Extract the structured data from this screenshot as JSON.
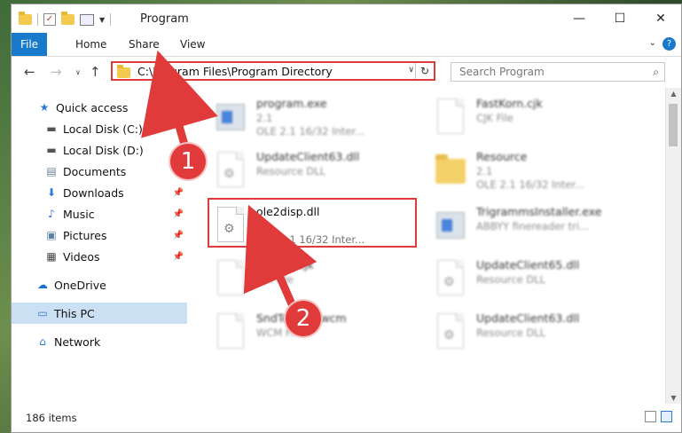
{
  "window": {
    "title": "Program"
  },
  "title_buttons": {
    "minimize": "—",
    "maximize": "☐",
    "close": "✕"
  },
  "ribbon": {
    "tabs": [
      "File",
      "Home",
      "Share",
      "View"
    ],
    "help": "?"
  },
  "address": {
    "path": "C:\\Program Files\\Program Directory"
  },
  "search": {
    "placeholder": "Search Program"
  },
  "nav": {
    "items": [
      {
        "label": "Quick access",
        "icon": "star-icon"
      },
      {
        "label": "Local Disk (C:)",
        "icon": "drive-icon"
      },
      {
        "label": "Local Disk (D:)",
        "icon": "drive-icon"
      },
      {
        "label": "Documents",
        "icon": "documents-icon"
      },
      {
        "label": "Downloads",
        "icon": "download-icon"
      },
      {
        "label": "Music",
        "icon": "music-icon"
      },
      {
        "label": "Pictures",
        "icon": "pictures-icon"
      },
      {
        "label": "Videos",
        "icon": "videos-icon"
      },
      {
        "label": "OneDrive",
        "icon": "cloud-icon"
      },
      {
        "label": "This PC",
        "icon": "computer-icon"
      },
      {
        "label": "Network",
        "icon": "network-icon"
      }
    ]
  },
  "files": [
    {
      "name": "program.exe",
      "line1": "2.1",
      "line2": "OLE 2.1 16/32 Inter..."
    },
    {
      "name": "FastKorn.cjk",
      "line1": "CJK File",
      "line2": ""
    },
    {
      "name": "UpdateClient63.dll",
      "line1": "Resource DLL",
      "line2": ""
    },
    {
      "name": "Resource",
      "line1": "2.1",
      "line2": "OLE 2.1 16/32 Inter..."
    },
    {
      "name": "ole2disp.dll",
      "line1": "2.1",
      "line2": "OLE 2.1 16/32 Inter..."
    },
    {
      "name": "TrigrammsInstaller.exe",
      "line1": "ABBYY finereader tri...",
      "line2": ""
    },
    {
      "name": "Korean.cjk",
      "line1": "CJK File",
      "line2": ""
    },
    {
      "name": "UpdateClient65.dll",
      "line1": "Resource DLL",
      "line2": ""
    },
    {
      "name": "SndToWcm.wcm",
      "line1": "WCM File",
      "line2": ""
    },
    {
      "name": "UpdateClient63.dll",
      "line1": "Resource DLL",
      "line2": ""
    }
  ],
  "status": {
    "count": "186 items"
  },
  "annotations": {
    "step1": "1",
    "step2": "2",
    "color": "#e03a3a"
  }
}
